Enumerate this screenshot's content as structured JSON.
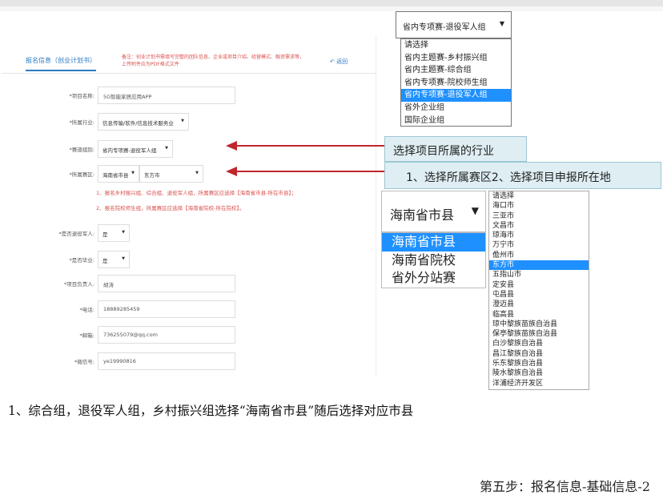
{
  "form": {
    "tab_active": "报名信息（创业计划书）",
    "tab_note": "备注：创业计划书需填写完整的团队信息、企业或项目介绍、经营模式、融资需求等，上传附件应为PDF格式文件",
    "back_link": "返回",
    "project_name": {
      "label": "*项目名称:",
      "value": "5G智能家居应用APP"
    },
    "industry": {
      "label": "*所属行业:",
      "value": "信息传输/软件/信息技术服务业"
    },
    "track": {
      "label": "*赛道组别:",
      "value": "省内专项赛-退役军人组"
    },
    "region": {
      "label": "*所属赛区:",
      "value1": "海南省市县",
      "value2": "东方市"
    },
    "note1": "1、报名乡村振兴组、综合组、退役军人组，所属赛区应选择【海南省市县-所在市县】；",
    "note2": "2、报名院校师生组，所属赛区应选择【海南省院校-所在院校】。",
    "is_veteran": {
      "label": "*是否退役军人:",
      "value": "是"
    },
    "is_graduate": {
      "label": "*是否毕业:",
      "value": "是"
    },
    "leader": {
      "label": "*项目负责人:",
      "value": "胡涛"
    },
    "phone": {
      "label": "*电话:",
      "value": "18889285459"
    },
    "email": {
      "label": "*邮箱:",
      "value": "736255079@qq.com"
    },
    "wechat": {
      "label": "*微信号:",
      "value": "ye19990816"
    }
  },
  "dropdown_track": {
    "selected": "省内专项赛-退役军人组",
    "options": [
      "请选择",
      "省内主题赛-乡村振兴组",
      "省内主题赛-综合组",
      "省内专项赛-院校师生组",
      "省内专项赛-退役军人组",
      "省外企业组",
      "国际企业组"
    ],
    "highlighted_index": 4
  },
  "callouts": {
    "industry": "选择项目所属的行业",
    "region": "1、选择所属赛区2、选择项目申报所在地"
  },
  "dropdown_region": {
    "selected": "海南省市县",
    "options": [
      "海南省市县",
      "海南省院校",
      "省外分站赛"
    ],
    "highlighted_index": 0
  },
  "dropdown_city": {
    "options": [
      "请选择",
      "海口市",
      "三亚市",
      "文昌市",
      "琼海市",
      "万宁市",
      "儋州市",
      "东方市",
      "五指山市",
      "定安县",
      "屯昌县",
      "澄迈县",
      "临高县",
      "琼中黎族苗族自治县",
      "保亭黎族苗族自治县",
      "白沙黎族自治县",
      "昌江黎族自治县",
      "乐东黎族自治县",
      "陵水黎族自治县",
      "洋浦经济开发区"
    ],
    "highlighted_index": 7
  },
  "caption": "1、综合组，退役军人组，乡村振兴组选择“海南省市县”随后选择对应市县",
  "step_title": "第五步：报名信息-基础信息-2",
  "colors": {
    "accent": "#1e90ff",
    "arrow": "#c0272d",
    "note": "#d9534f",
    "callout_bg": "#dfeef3"
  }
}
